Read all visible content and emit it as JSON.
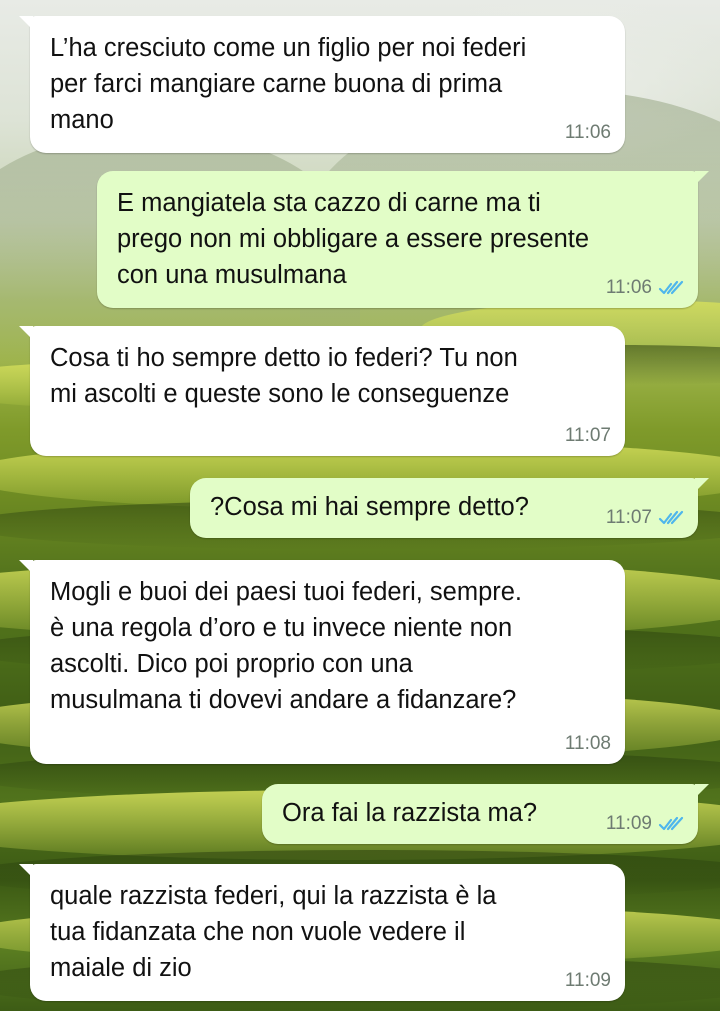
{
  "conversation": {
    "messages": [
      {
        "direction": "incoming",
        "text": "L’ha cresciuto come un figlio per noi federi\nper farci mangiare carne buona di prima\nmano",
        "time": "11:06"
      },
      {
        "direction": "outgoing",
        "text": "E mangiatela sta cazzo di carne ma ti\nprego non mi obbligare a essere presente\ncon una musulmana",
        "time": "11:06",
        "status": "read",
        "status_icon": "double-check-icon"
      },
      {
        "direction": "incoming",
        "text": "Cosa ti ho sempre detto io federi? Tu non\nmi ascolti e queste sono le conseguenze",
        "time": "11:07"
      },
      {
        "direction": "outgoing",
        "text": "?Cosa mi hai sempre detto?",
        "time": "11:07",
        "status": "read",
        "status_icon": "double-check-icon"
      },
      {
        "direction": "incoming",
        "text": "Mogli e buoi dei paesi tuoi federi, sempre.\nè una regola d’oro e tu invece niente non\nascolti. Dico poi proprio con una\nmusulmana ti dovevi andare a fidanzare?",
        "time": "11:08"
      },
      {
        "direction": "outgoing",
        "text": "Ora fai la razzista ma?",
        "time": "11:09",
        "status": "read",
        "status_icon": "double-check-icon"
      },
      {
        "direction": "incoming",
        "text": "quale razzista federi, qui la razzista è la\ntua fidanzata che non vuole vedere il\nmaiale di zio",
        "time": "11:09"
      }
    ]
  },
  "theme": {
    "incoming_bubble": "#ffffff",
    "outgoing_bubble": "#e2fdc7",
    "read_tick_color": "#4fb6ec",
    "time_color": "#6e7b72",
    "wallpaper": "green rice terraces"
  }
}
